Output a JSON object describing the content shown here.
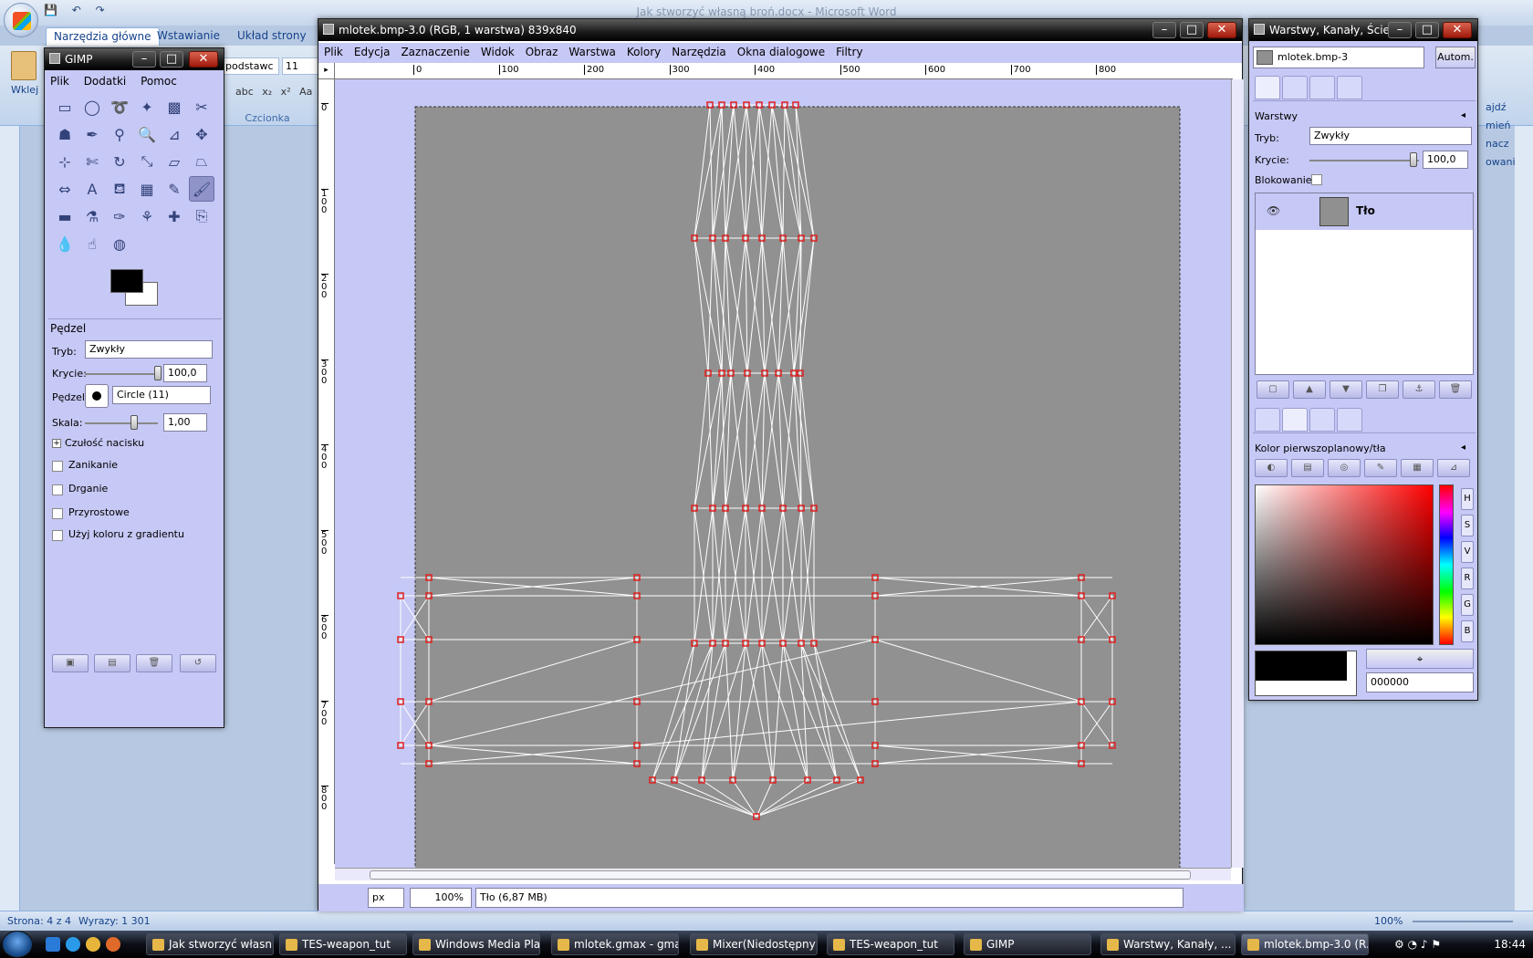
{
  "word": {
    "title": "Jak stworzyć własną broń.docx - Microsoft Word",
    "tabs": [
      "Narzędzia główne",
      "Wstawianie",
      "Układ strony"
    ],
    "paste_label": "Wklej",
    "font_name": "podstawc",
    "font_size": "11",
    "format_buttons": "abc x₂ x² Aa",
    "font_group_label": "Czcionka",
    "right_ribbon": [
      "ajdź",
      "mień",
      "nacz",
      "owanie"
    ],
    "status": {
      "page": "Strona: 4 z 4",
      "words": "Wyrazy: 1 301",
      "zoom": "100%"
    }
  },
  "toolbox": {
    "title": "GIMP",
    "menu": [
      "Plik",
      "Dodatki",
      "Pomoc"
    ],
    "tools": [
      "rect-select",
      "ellipse-select",
      "free-select",
      "fuzzy-select",
      "color-select",
      "scissors-select",
      "foreground-select",
      "paths",
      "color-picker",
      "zoom",
      "measure",
      "move",
      "align",
      "crop",
      "rotate",
      "scale",
      "shear",
      "perspective",
      "flip",
      "text",
      "bucket-fill",
      "blend",
      "pencil",
      "paintbrush",
      "eraser",
      "airbrush",
      "ink",
      "clone",
      "heal",
      "perspective-clone",
      "blur",
      "smudge",
      "dodge-burn"
    ],
    "active_tool": "paintbrush",
    "options": {
      "title": "Pędzel",
      "mode_label": "Tryb:",
      "mode_value": "Zwykły",
      "opacity_label": "Krycie:",
      "opacity_value": "100,0",
      "brush_label": "Pędzel:",
      "brush_value": "Circle (11)",
      "scale_label": "Skala:",
      "scale_value": "1,00",
      "pressure_label": "Czułość nacisku",
      "checkboxes": [
        "Zanikanie",
        "Drganie",
        "Przyrostowe",
        "Użyj koloru z gradientu"
      ]
    }
  },
  "image_window": {
    "title": "mlotek.bmp-3.0 (RGB, 1 warstwa) 839x840",
    "menu": [
      "Plik",
      "Edycja",
      "Zaznaczenie",
      "Widok",
      "Obraz",
      "Warstwa",
      "Kolory",
      "Narzędzia",
      "Okna dialogowe",
      "Filtry"
    ],
    "hruler_ticks": [
      "0",
      "100",
      "200",
      "300",
      "400",
      "500",
      "600",
      "700",
      "800"
    ],
    "vruler_ticks": [
      "0",
      "100",
      "200",
      "300",
      "400",
      "500",
      "600",
      "700",
      "800"
    ],
    "unit": "px",
    "zoom": "100%",
    "layer_info": "Tło (6,87 MB)",
    "colors": {
      "canvas": "#919191",
      "wire": "#ffffff",
      "vertex": "#e02020",
      "backdrop": "#c6c8f5"
    }
  },
  "dock": {
    "title": "Warstwy, Kanały, Ście...",
    "image_select": "mlotek.bmp-3",
    "auto_button": "Autom.",
    "layers_title": "Warstwy",
    "mode_label": "Tryb:",
    "mode_value": "Zwykły",
    "opacity_label": "Krycie:",
    "opacity_value": "100,0",
    "lock_label": "Blokowanie:",
    "layer_name": "Tło",
    "color_title": "Kolor pierwszoplanowy/tła",
    "channels": [
      "H",
      "S",
      "V",
      "R",
      "G",
      "B"
    ],
    "hex_value": "000000"
  },
  "taskbar": {
    "tasks": [
      "Jak stworzyć własn...",
      "TES-weapon_tut",
      "Windows Media Pla...",
      "mlotek.gmax - gmax",
      "Mixer(Niedostępny)",
      "TES-weapon_tut",
      "GIMP",
      "Warstwy, Kanały, ...",
      "mlotek.bmp-3.0 (R..."
    ],
    "clock": "18:44"
  }
}
